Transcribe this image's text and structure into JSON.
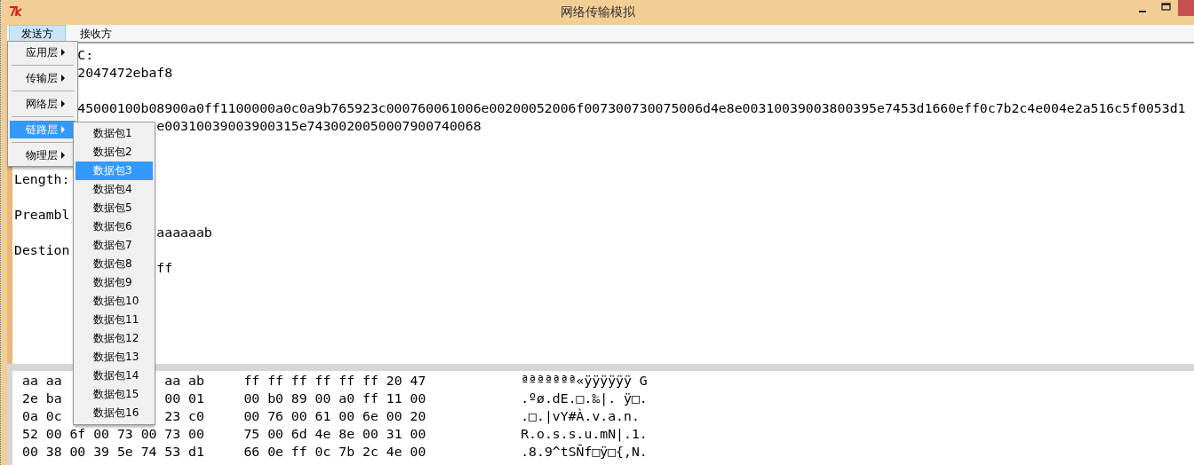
{
  "window": {
    "title": "网络传输模拟"
  },
  "menubar": [
    {
      "label": "发送方",
      "selected": true
    },
    {
      "label": "接收方",
      "selected": false
    }
  ],
  "layer_menu": [
    {
      "label": "应用层",
      "selected": false
    },
    {
      "label": "传输层",
      "selected": false
    },
    {
      "label": "网络层",
      "selected": false
    },
    {
      "label": "链路层",
      "selected": true
    },
    {
      "label": "物理层",
      "selected": false
    }
  ],
  "packet_menu": [
    {
      "label": "数据包1",
      "selected": false
    },
    {
      "label": "数据包2",
      "selected": false
    },
    {
      "label": "数据包3",
      "selected": true
    },
    {
      "label": "数据包4",
      "selected": false
    },
    {
      "label": "数据包5",
      "selected": false
    },
    {
      "label": "数据包6",
      "selected": false
    },
    {
      "label": "数据包7",
      "selected": false
    },
    {
      "label": "数据包8",
      "selected": false
    },
    {
      "label": "数据包9",
      "selected": false
    },
    {
      "label": "数据包10",
      "selected": false
    },
    {
      "label": "数据包11",
      "selected": false
    },
    {
      "label": "数据包12",
      "selected": false
    },
    {
      "label": "数据包13",
      "selected": false
    },
    {
      "label": "数据包14",
      "selected": false
    },
    {
      "label": "数据包15",
      "selected": false
    },
    {
      "label": "数据包16",
      "selected": false
    }
  ],
  "detail_lines": [
    {
      "kind": "near",
      "value": "C:"
    },
    {
      "kind": "near",
      "value": "2047472ebaf8"
    },
    {
      "kind": "blank"
    },
    {
      "kind": "near",
      "value": "45000100b08900a0ff1100000a0c0a9b765923c000760061006e00200052006f007300730075006d4e8e00310039003800395e7453d1660eff0c7b2c4e004e2a516c5f0053d1"
    },
    {
      "kind": "far",
      "value": "e00310039003900315e7430020050007900740068"
    },
    {
      "kind": "blank"
    },
    {
      "kind": "blank"
    },
    {
      "kind": "label",
      "label": "Length:"
    },
    {
      "kind": "blank"
    },
    {
      "kind": "label",
      "label": "Preambl"
    },
    {
      "kind": "far",
      "value": "aaaaaab"
    },
    {
      "kind": "label",
      "label": "Destion"
    },
    {
      "kind": "far",
      "value": "ff"
    }
  ],
  "hex_rows": [
    {
      "hex_left": "aa aa",
      "hex_right": "aa ab",
      "hex_mid": "ff ff ff ff ff ff 20 47",
      "ascii": "ªªªªªªª«ÿÿÿÿÿÿ G"
    },
    {
      "hex_left": "2e ba",
      "hex_right": "00 01",
      "hex_mid": "00 b0 89 00 a0 ff 11 00",
      "ascii": ".ºø.dE.□.‰|. ÿ□."
    },
    {
      "hex_left": "0a 0c",
      "hex_right": "23 c0",
      "hex_mid": "00 76 00 61 00 6e 00 20",
      "ascii": ".□.|vY#À.v.a.n."
    },
    {
      "hex_left": "52 00 6f 00 73 00 73 00",
      "hex_mid": "75 00 6d 4e 8e 00 31 00",
      "ascii": "R.o.s.s.u.mN|.1."
    },
    {
      "hex_left": "00 38 00 39 5e 74 53 d1",
      "hex_mid": "66 0e ff 0c 7b 2c 4e 00",
      "ascii": ".8.9^tSÑf□ÿ□{,N."
    }
  ]
}
